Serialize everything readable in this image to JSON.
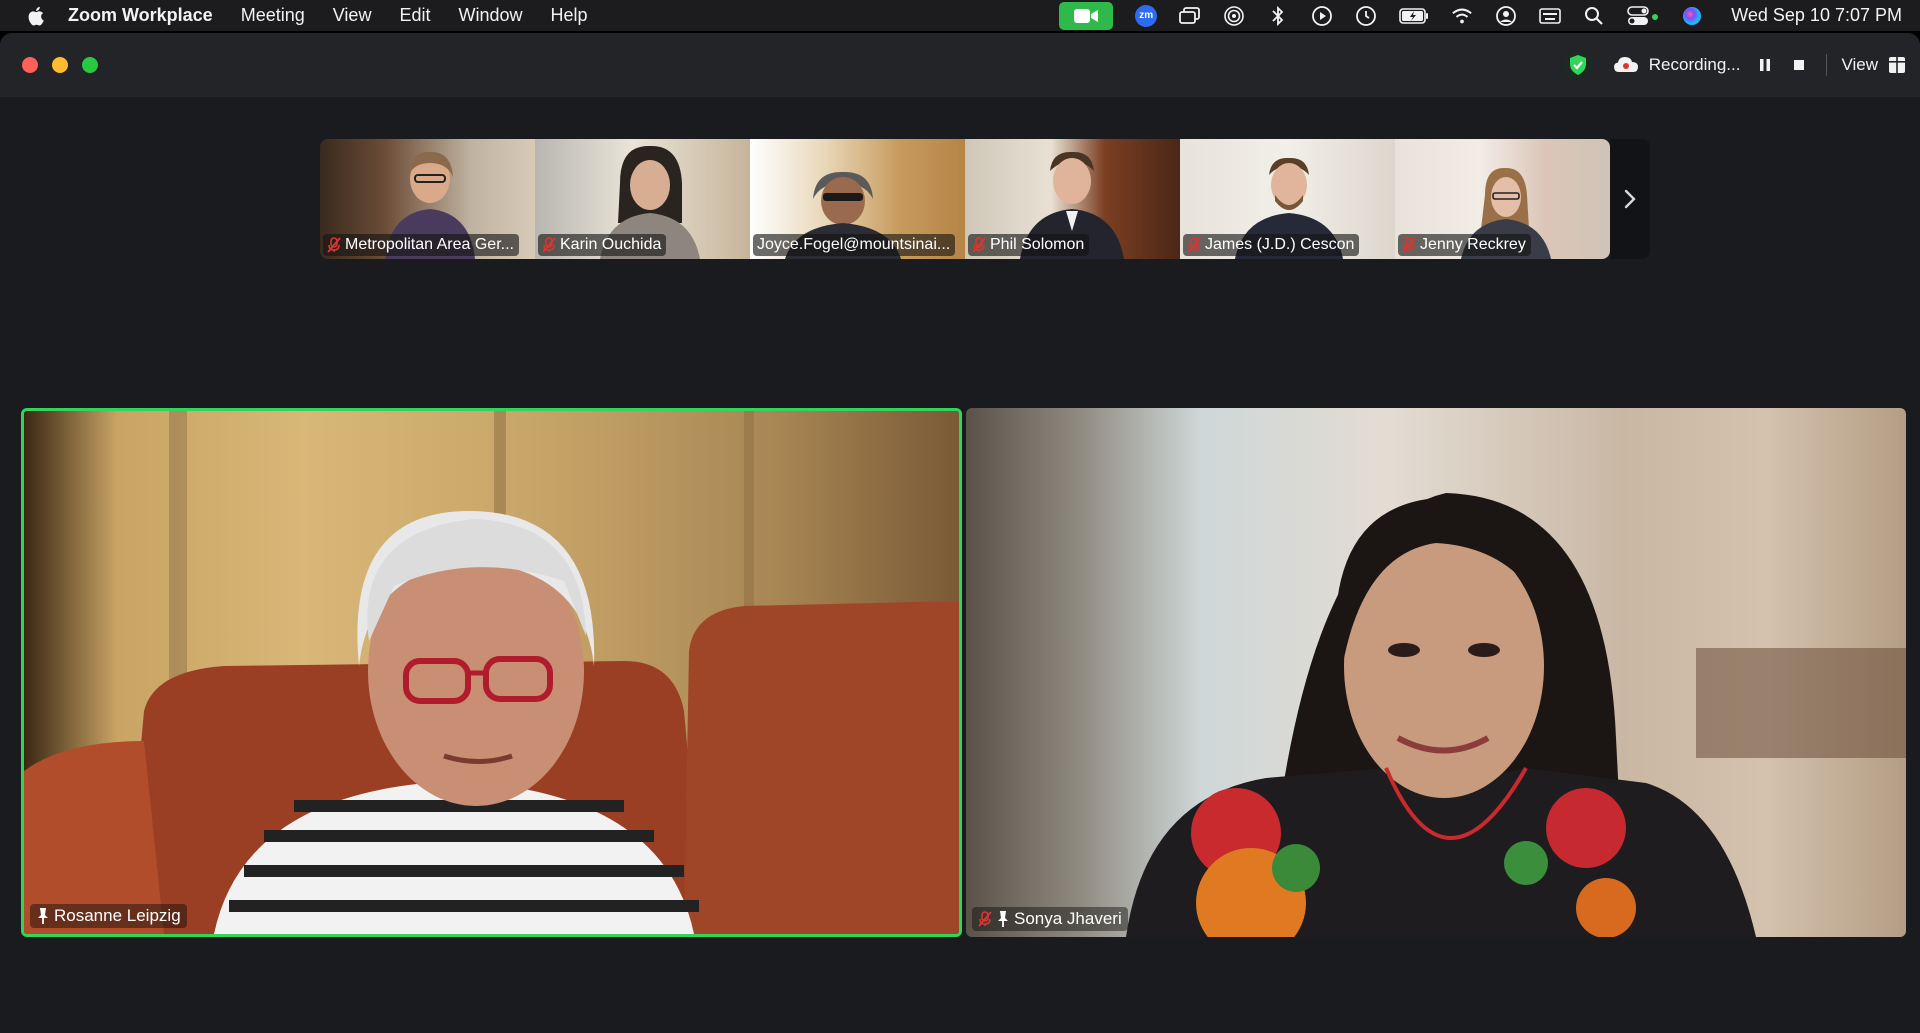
{
  "menubar": {
    "app_name": "Zoom Workplace",
    "items": [
      "Meeting",
      "View",
      "Edit",
      "Window",
      "Help"
    ],
    "zm_badge": "zm",
    "clock": "Wed Sep 10  7:07 PM"
  },
  "titlebar": {
    "recording_label": "Recording...",
    "view_label": "View"
  },
  "gallery": [
    {
      "name": "Metropolitan Area Ger...",
      "muted": true
    },
    {
      "name": "Karin Ouchida",
      "muted": true
    },
    {
      "name": "Joyce.Fogel@mountsinai...",
      "muted": false
    },
    {
      "name": "Phil Solomon",
      "muted": true
    },
    {
      "name": "James (J.D.) Cescon",
      "muted": true
    },
    {
      "name": "Jenny Reckrey",
      "muted": true
    }
  ],
  "speakers": [
    {
      "name": "Rosanne Leipzig",
      "active": true,
      "muted": false,
      "spotlight": true
    },
    {
      "name": "Sonya Jhaveri",
      "active": false,
      "muted": true,
      "spotlight": true
    }
  ],
  "colors": {
    "accent_green": "#2fd65a",
    "mute_red": "#e0332e",
    "cam_green": "#2fb94a"
  }
}
